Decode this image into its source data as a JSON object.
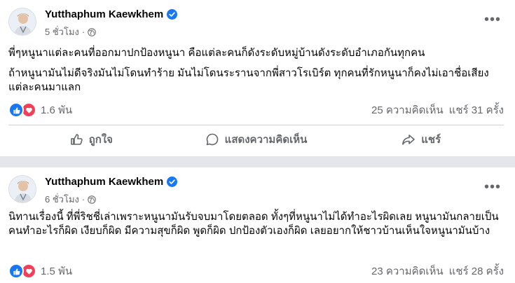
{
  "posts": [
    {
      "author": "Yutthaphum Kaewkhem",
      "time": "5 ชั่วโมง",
      "paragraphs": [
        "พี่ๆหนูนาแต่ละคนที่ออกมาปกป้องหนูนา คือแต่ละคนก็ดังระดับหมู่บ้านดังระดับอำเภอกันทุกคน",
        "ถ้าหนูนามันไม่ดีจริงมันไม่โดนทำร้าย มันไม่โดนระรานจากพี่สาวโรเบิร์ต ⁣ทุกคนที่รักหนูนาก็คงไม่เอาชื่อเสียงแต่ละคนมาแลก"
      ],
      "reaction_count": "1.6 พัน",
      "comments": "25 ความคิดเห็น",
      "shares": "แชร์ 31 ครั้ง"
    },
    {
      "author": "Yutthaphum Kaewkhem",
      "time": "6 ชั่วโมง",
      "paragraphs": [
        "นิทานเรื่องนี้ ที่พี่ริชชี่เล่าเพราะหนูนามันรับจบมาโดยตลอด ทั้งๆที่หนูนาไม่ได้ทำอะไรผิดเลย หนูนามันกลายเป็นคนทำอะไรก็ผิด เงียบก็ผิด มีความสุขก็ผิด พูดก็ผิด ปกป้องตัวเองก็ผิด เลยอยากให้ชาวบ้านเห็นใจหนูนามันบ้าง"
      ],
      "reaction_count": "1.5 พัน",
      "comments": "23 ความคิดเห็น",
      "shares": "แชร์ 28 ครั้ง"
    }
  ],
  "actions": {
    "like": "ถูกใจ",
    "comment": "แสดงความคิดเห็น",
    "share": "แชร์"
  },
  "colors": {
    "verified": "#1877f2",
    "like": "#1877f2",
    "love": "#f33e58",
    "secondary_text": "#65676b"
  },
  "icons": [
    "verified-badge-icon",
    "globe-icon",
    "more-icon",
    "like-reaction-icon",
    "love-reaction-icon",
    "thumb-up-icon",
    "comment-icon",
    "share-icon"
  ]
}
